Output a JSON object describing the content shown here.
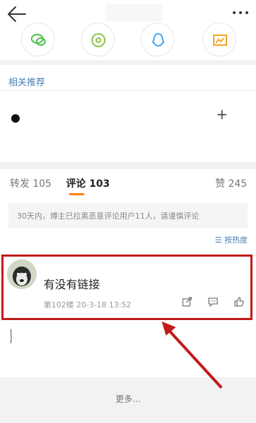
{
  "header": {
    "back_icon": "arrow-left-icon",
    "more_icon": "more-dots-icon"
  },
  "share_icons": [
    "wechat-icon",
    "moments-icon",
    "qq-icon",
    "qzone-icon"
  ],
  "recommend": {
    "title": "相关推荐"
  },
  "tabs": [
    {
      "label": "转发 105"
    },
    {
      "label": "评论 103"
    },
    {
      "label": "赞 245"
    }
  ],
  "notice": {
    "text": "30天内，博主已拉黑恶意评论用户11人，请谨慎评论"
  },
  "sort": {
    "label": "按热度"
  },
  "comment": {
    "text": "有没有链接",
    "floor": "第102楼",
    "time": "20-3-18 13:52",
    "actions": [
      "share-icon",
      "reply-icon",
      "like-icon"
    ]
  },
  "footer": {
    "more": "更多..."
  },
  "colors": {
    "accent": "#ff8200",
    "link": "#4a7fb5",
    "highlight": "#c01a1a"
  }
}
